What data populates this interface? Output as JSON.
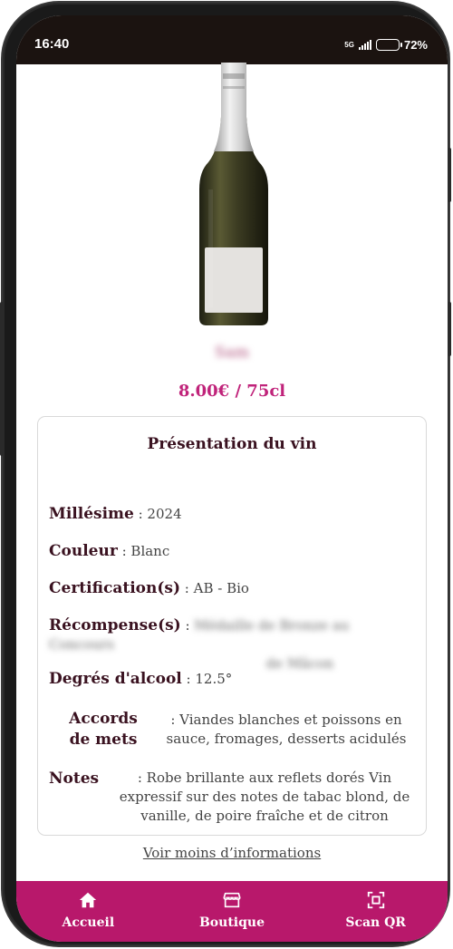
{
  "status_bar": {
    "time": "16:40",
    "network": "5G",
    "battery_percent": "72%",
    "battery_level": 0.72
  },
  "product": {
    "name": "Sam",
    "price": "8.00€ / 75cl"
  },
  "presentation": {
    "title": "Présentation du vin",
    "millesime_label": "Millésime",
    "millesime_value": " : 2024",
    "couleur_label": "Couleur",
    "couleur_value": " : Blanc",
    "certification_label": "Certification(s)",
    "certification_value": " : AB - Bio",
    "recompense_label": "Récompense(s)",
    "recompense_sep": " : ",
    "recompense_value_line1": "Médaille de Bronze au Concours",
    "recompense_value_line2": "de Mâcon",
    "degres_label": "Degrés d'alcool",
    "degres_value": " : 12.5°",
    "accords_label_line1": "Accords",
    "accords_label_line2": "de mets",
    "accords_value_line1": ": Viandes blanches et poissons en",
    "accords_value_line2": "sauce, fromages, desserts acidulés",
    "notes_label": "Notes",
    "notes_value_line1": ": Robe brillante aux reflets dorés   Vin",
    "notes_value_line2": "expressif sur des notes de tabac blond, de",
    "notes_value_line3": "vanille, de poire fraîche et de citron"
  },
  "toggle_info": "Voir moins d’informations",
  "nav": {
    "home": {
      "label": "Accueil",
      "icon": "home-icon"
    },
    "shop": {
      "label": "Boutique",
      "icon": "store-icon"
    },
    "scan": {
      "label": "Scan QR",
      "icon": "scan-qr-icon"
    }
  },
  "colors": {
    "accent": "#b8186b",
    "price": "#c0237a",
    "label": "#3a1220",
    "status_bar": "#1b1310"
  }
}
